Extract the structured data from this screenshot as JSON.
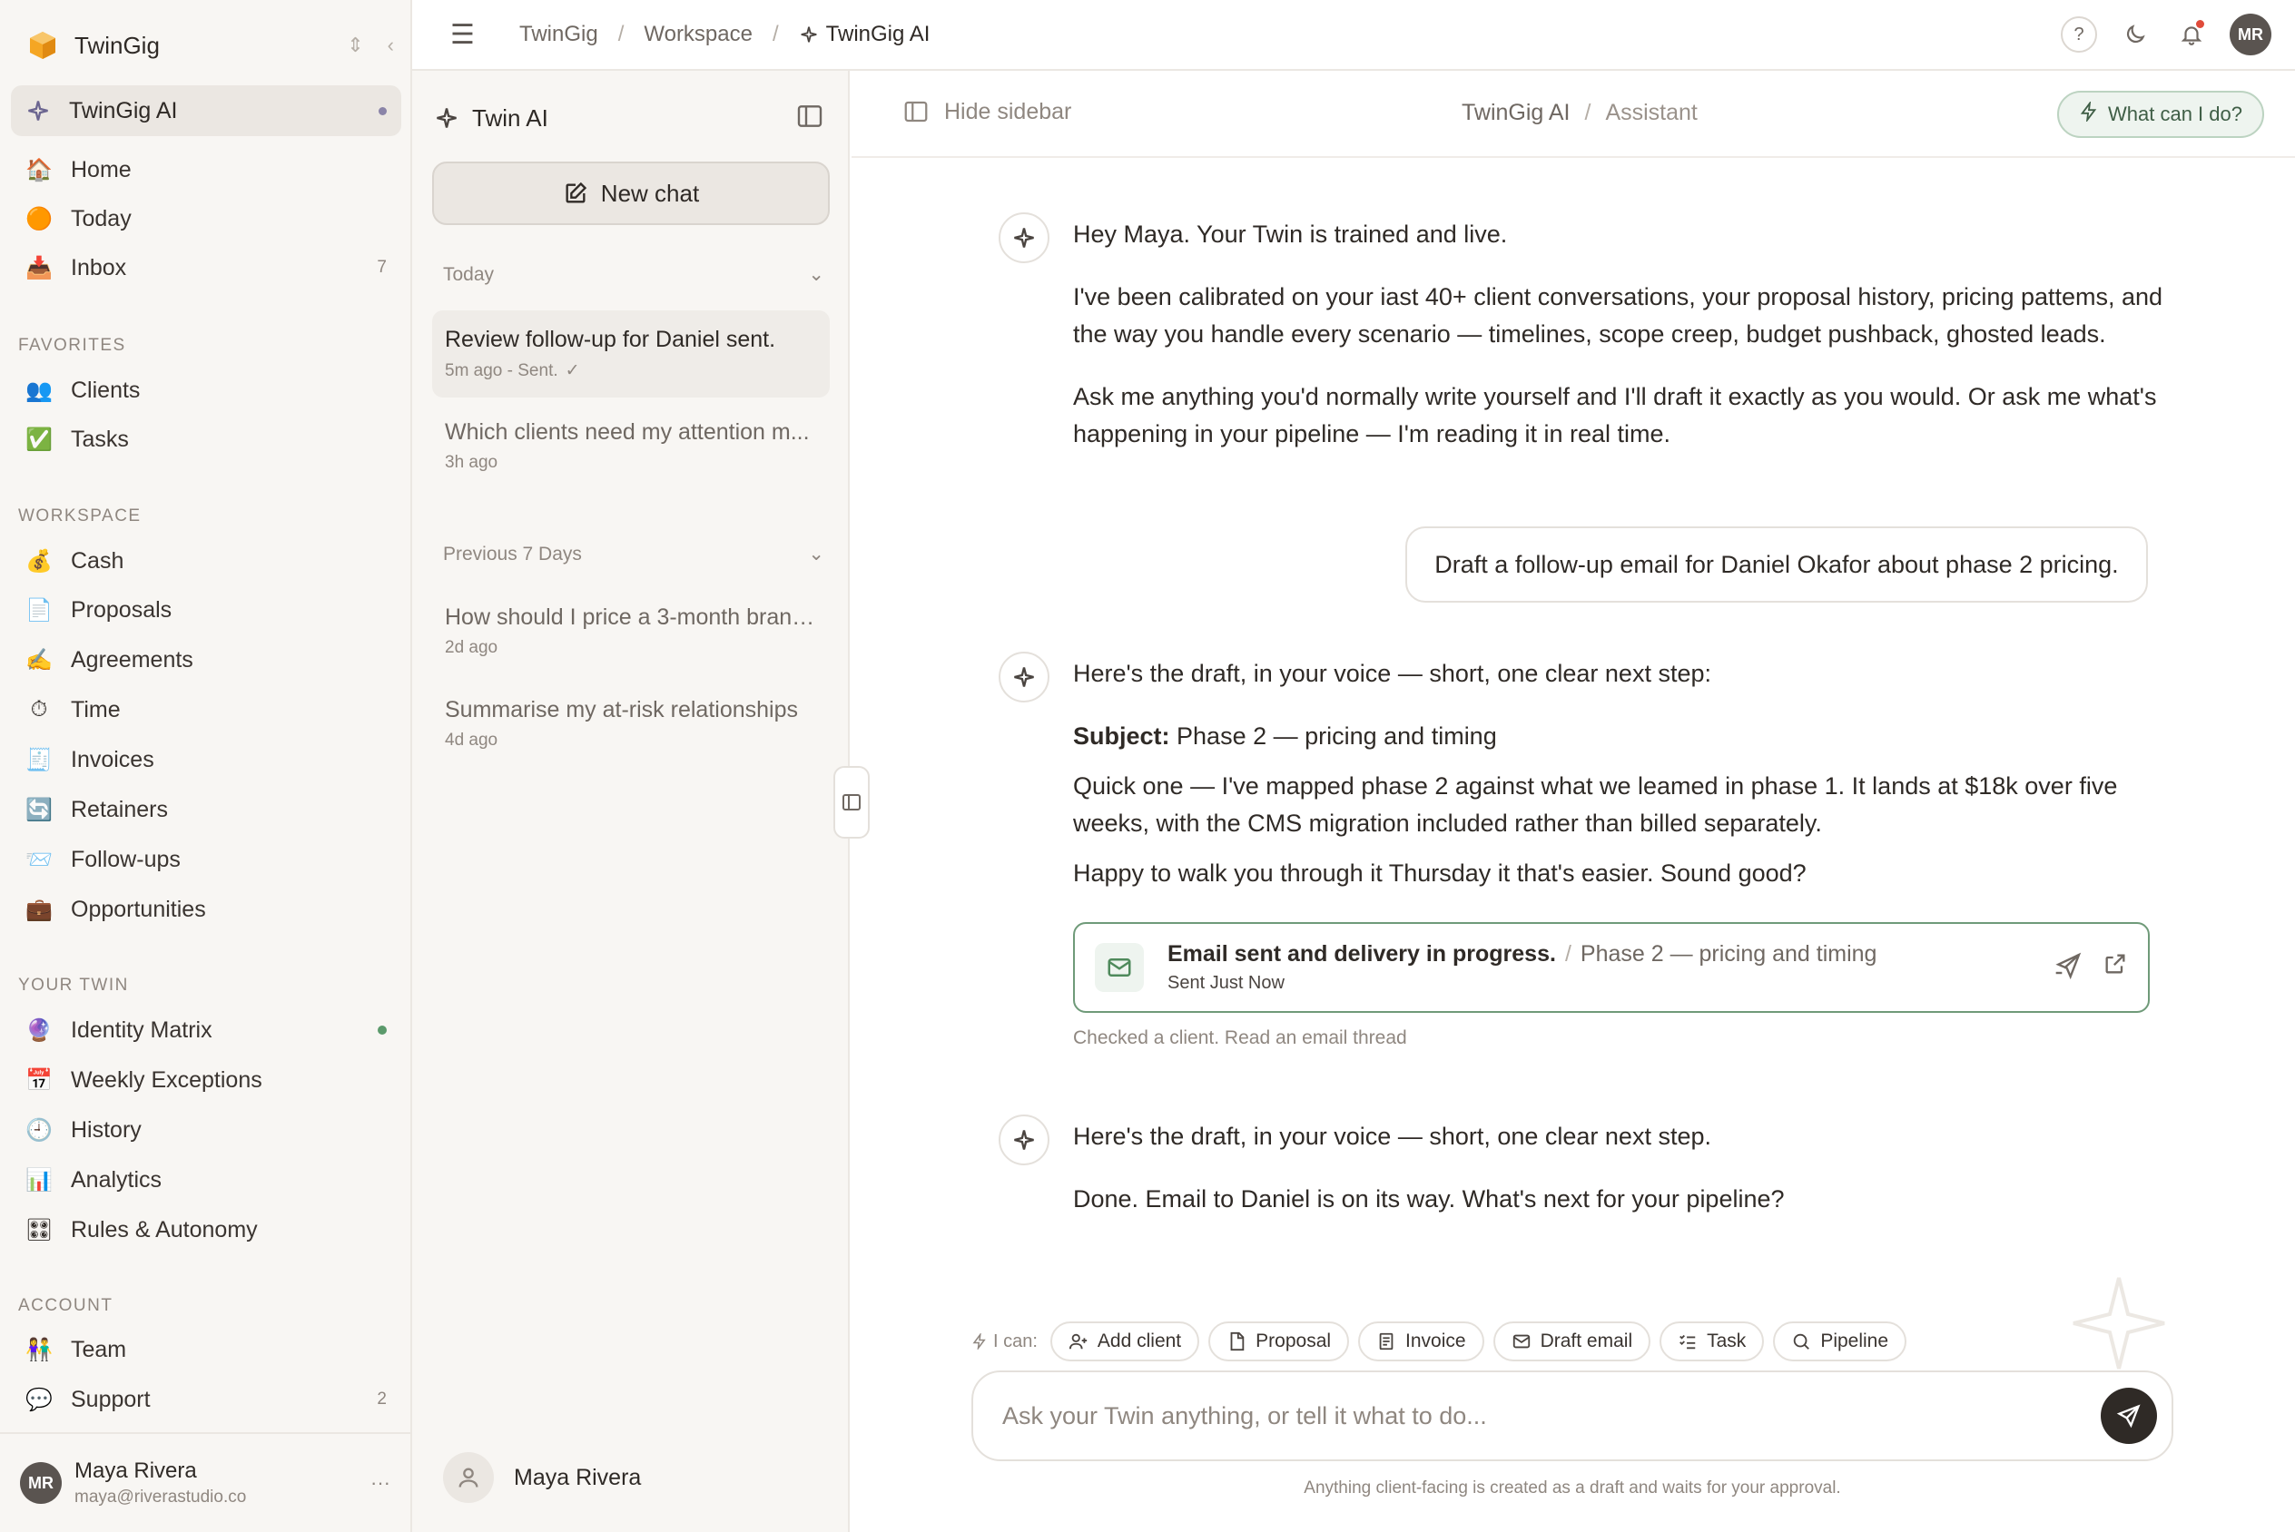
{
  "sidebar": {
    "brand": "TwinGig",
    "active_item": "TwinGig AI",
    "nav": [
      {
        "label": "Home",
        "icon": "home-icon",
        "count": ""
      },
      {
        "label": "Today",
        "icon": "today-icon",
        "count": ""
      },
      {
        "label": "Inbox",
        "icon": "inbox-icon",
        "count": "7"
      }
    ],
    "favorites_title": "FAVORITES",
    "favorites": [
      {
        "label": "Clients",
        "icon": "clients-icon"
      },
      {
        "label": "Tasks",
        "icon": "tasks-icon"
      }
    ],
    "workspace_title": "WORKSPACE",
    "workspace": [
      {
        "label": "Cash",
        "icon": "cash-icon"
      },
      {
        "label": "Proposals",
        "icon": "proposals-icon"
      },
      {
        "label": "Agreements",
        "icon": "agreements-icon"
      },
      {
        "label": "Time",
        "icon": "time-icon"
      },
      {
        "label": "Invoices",
        "icon": "invoices-icon"
      },
      {
        "label": "Retainers",
        "icon": "retainers-icon"
      },
      {
        "label": "Follow-ups",
        "icon": "followups-icon"
      },
      {
        "label": "Opportunities",
        "icon": "opportunities-icon"
      }
    ],
    "twin_title": "YOUR TWIN",
    "twin": [
      {
        "label": "Identity Matrix",
        "icon": "identity-icon"
      },
      {
        "label": "Weekly Exceptions",
        "icon": "calendar-icon"
      },
      {
        "label": "History",
        "icon": "history-icon"
      },
      {
        "label": "Analytics",
        "icon": "analytics-icon"
      },
      {
        "label": "Rules & Autonomy",
        "icon": "rules-icon"
      }
    ],
    "account_title": "ACCOUNT",
    "account": [
      {
        "label": "Team",
        "icon": "team-icon",
        "count": ""
      },
      {
        "label": "Support",
        "icon": "support-icon",
        "count": "2"
      }
    ],
    "user": {
      "initials": "MR",
      "name": "Maya Rivera",
      "email": "maya@riverastudio.co"
    }
  },
  "topbar": {
    "crumbs": [
      "TwinGig",
      "Workspace",
      "TwinGig AI"
    ],
    "help": "?",
    "avatar": "MR"
  },
  "chatlist": {
    "title": "Twin AI",
    "new_chat": "New chat",
    "group_today": "Today",
    "group_prev": "Previous 7 Days",
    "items": [
      {
        "title": "Review follow-up for Daniel sent.",
        "meta": "5m ago - Sent."
      },
      {
        "title": "Which clients need my attention m...",
        "meta": "3h ago"
      },
      {
        "title": "How should I price a 3-month brand...",
        "meta": "2d ago"
      },
      {
        "title": "Summarise my at-risk relationships",
        "meta": "4d ago"
      }
    ],
    "user_name": "Maya Rivera"
  },
  "main": {
    "hide_sidebar": "Hide sidebar",
    "crumb_a": "TwinGig AI",
    "crumb_sep": "/",
    "crumb_b": "Assistant",
    "what_can": "What can I do?",
    "m1": {
      "p1": "Hey Maya. Your Twin is trained and live.",
      "p2": "I've been calibrated on your iast 40+ client conversations, your proposal history, pricing pattems, and the way you handle every scenario — timelines, scope creep, budget pushback, ghosted leads.",
      "p3": "Ask me anything you'd normally write yourself and I'll draft it exactly as you would. Or ask me what's happening in your pipeline — I'm reading it in real time."
    },
    "user_msg": "Draft a follow-up email for Daniel Okafor about phase 2 pricing.",
    "m2": {
      "intro": "Here's the draft, in your voice — short, one clear next step:",
      "subject_label": "Subject:",
      "subject": "Phase 2 — pricing and timing",
      "body1": "Quick one — I've mapped phase 2 against what we leamed in phase 1. It lands at $18k over five weeks, with the CMS migration included rather than billed separately.",
      "body2": "Happy to walk you through it Thursday it that's easier. Sound good?"
    },
    "email_card": {
      "status": "Email sent and delivery in progress.",
      "sep": "/",
      "subject": "Phase 2 — pricing and timing",
      "sent": "Sent Just Now"
    },
    "activity": "Checked a client.  Read an email thread",
    "m3": {
      "p1": "Here's the draft, in your voice — short, one clear next step.",
      "p2": "Done. Email to Daniel is on its way. What's next for your pipeline?"
    },
    "caps_label": "I can:",
    "chips": [
      {
        "label": "Add client",
        "icon": "add-client-icon"
      },
      {
        "label": "Proposal",
        "icon": "proposal-icon"
      },
      {
        "label": "Invoice",
        "icon": "invoice-icon"
      },
      {
        "label": "Draft email",
        "icon": "mail-icon"
      },
      {
        "label": "Task",
        "icon": "task-icon"
      },
      {
        "label": "Pipeline",
        "icon": "pipeline-icon"
      }
    ],
    "composer_placeholder": "Ask your Twin anything, or tell it what to do...",
    "disclaimer": "Anything client-facing is created as a draft and waits for your approval."
  },
  "colors": {
    "accent_green": "#6f9a79",
    "sidebar_bg": "#f8f6f3",
    "send_button": "#2f2a26"
  }
}
